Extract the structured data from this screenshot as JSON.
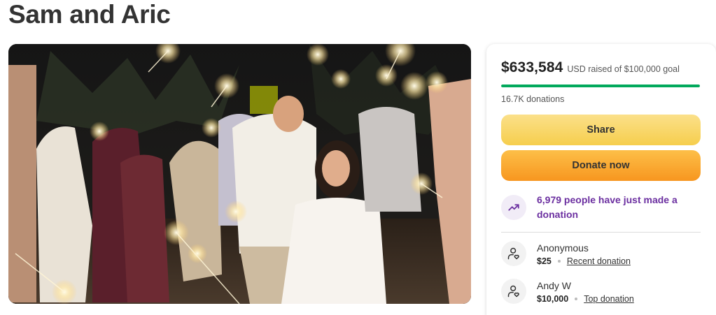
{
  "page": {
    "title": "Sam and Aric"
  },
  "photo": {
    "alt": "Wedding couple walking through a line of guests holding lit sparklers"
  },
  "fundraiser": {
    "amount_raised": "$633,584",
    "goal_text": "USD raised of $100,000 goal",
    "progress_fraction": 1.0,
    "donation_count": "16.7K donations",
    "share_label": "Share",
    "donate_label": "Donate now",
    "trend_text": "6,979 people have just made a donation",
    "trend_icon": "trending-up-icon",
    "colors": {
      "progress": "#02a95c",
      "share_button": "#f6ce4d",
      "donate_button": "#f7961f",
      "trend_text": "#6b2fa0"
    }
  },
  "donors": [
    {
      "name": "Anonymous",
      "amount": "$25",
      "tag": "Recent donation",
      "icon": "donor-heart-icon"
    },
    {
      "name": "Andy W",
      "amount": "$10,000",
      "tag": "Top donation",
      "icon": "donor-heart-icon"
    }
  ]
}
